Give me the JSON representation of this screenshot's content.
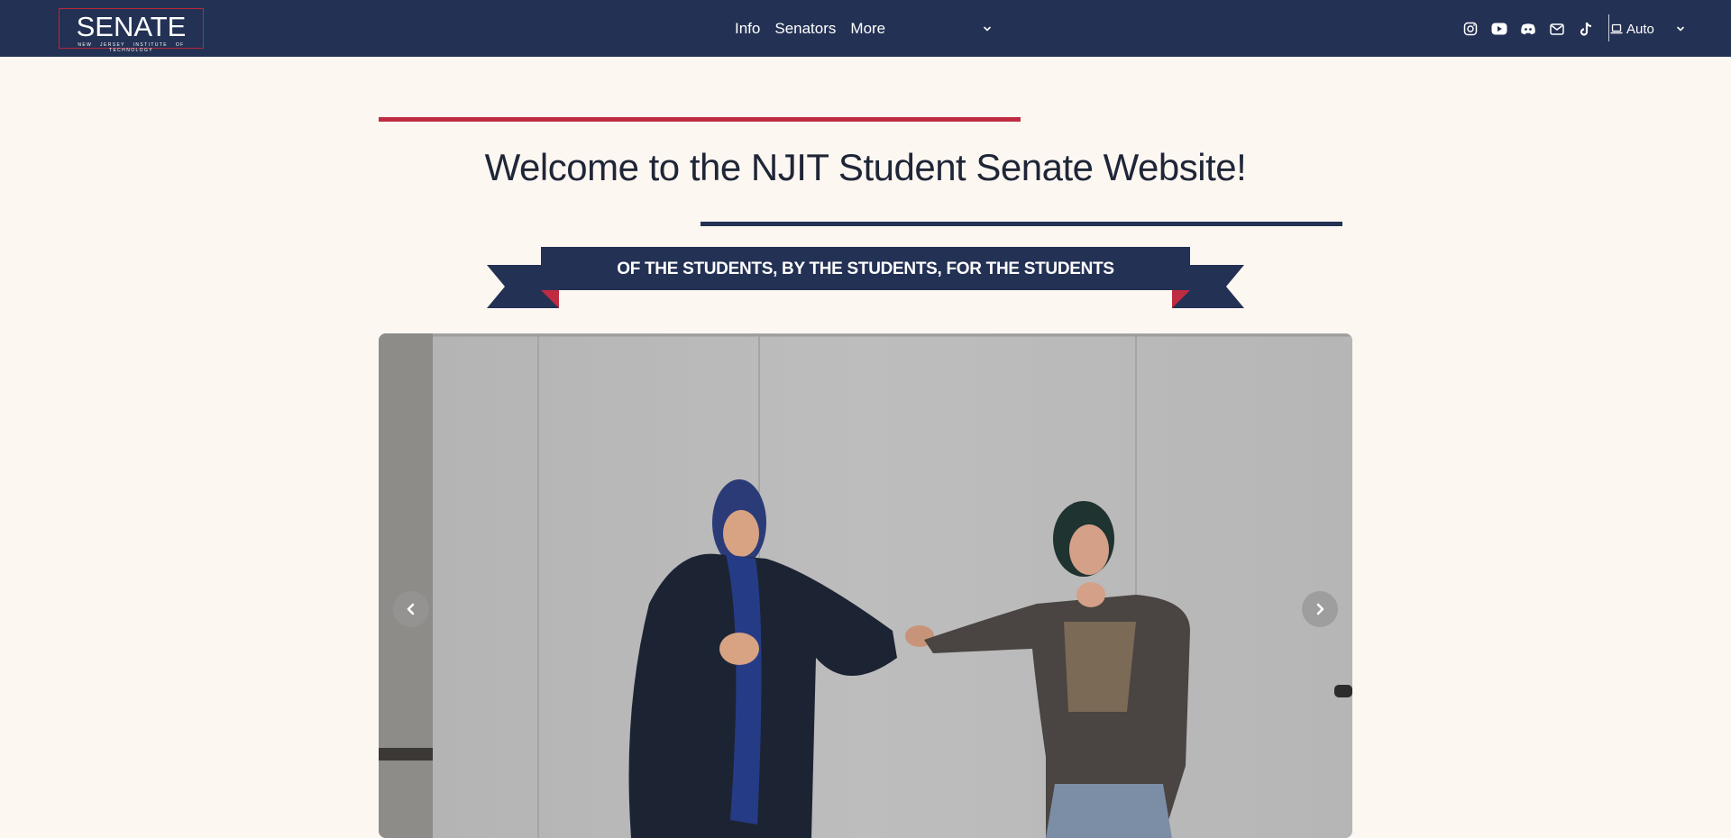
{
  "nav": {
    "logo_title": "SENATE",
    "logo_subtitle": "NEW JERSEY INSTITUTE OF TECHNOLOGY",
    "links": [
      "Info",
      "Senators",
      "More"
    ],
    "social_icons": [
      "instagram-icon",
      "youtube-icon",
      "discord-icon",
      "mail-icon",
      "tiktok-icon"
    ],
    "theme_label": "Auto",
    "theme_icon": "laptop-icon"
  },
  "hero": {
    "title": "Welcome to the NJIT Student Senate Website!",
    "banner": "OF THE STUDENTS, BY THE STUDENTS, FOR THE STUDENTS"
  },
  "carousel": {
    "prev_icon": "chevron-left-icon",
    "next_icon": "chevron-right-icon"
  },
  "colors": {
    "navbar": "#233154",
    "accent_red": "#bf2c42",
    "page_bg": "#fdf7f2"
  }
}
